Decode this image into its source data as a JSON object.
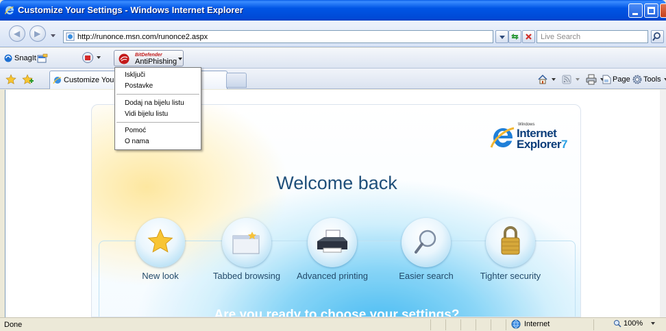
{
  "window": {
    "title": "Customize Your Settings - Windows Internet Explorer"
  },
  "address_bar": {
    "url": "http://runonce.msn.com/runonce2.aspx",
    "search_placeholder": "Live Search"
  },
  "toolbar": {
    "snagit_label": "SnagIt",
    "antiphishing_brand": "BitDefender",
    "antiphishing_label": "AntiPhishing"
  },
  "tabs": [
    {
      "label": "Customize Your Settings"
    }
  ],
  "command_bar": {
    "page_label": "Page",
    "tools_label": "Tools"
  },
  "antiphishing_menu": {
    "items": [
      "Isključi",
      "Postavke",
      "Dodaj na bijelu listu",
      "Vidi bijelu listu",
      "Pomoć",
      "O nama"
    ]
  },
  "content": {
    "logo": {
      "small": "Windows",
      "line1": "Internet",
      "line2": "Explorer",
      "version": "7"
    },
    "heading": "Welcome back",
    "features": [
      "New look",
      "Tabbed browsing",
      "Advanced printing",
      "Easier search",
      "Tighter security"
    ],
    "question": "Are you ready to choose your settings?"
  },
  "status_bar": {
    "status_text": "Done",
    "zone_label": "Internet",
    "zoom_label": "100%"
  },
  "colors": {
    "title_bar": "#0055e5",
    "heading": "#1f4f7a",
    "accent": "#2aa0e4"
  }
}
